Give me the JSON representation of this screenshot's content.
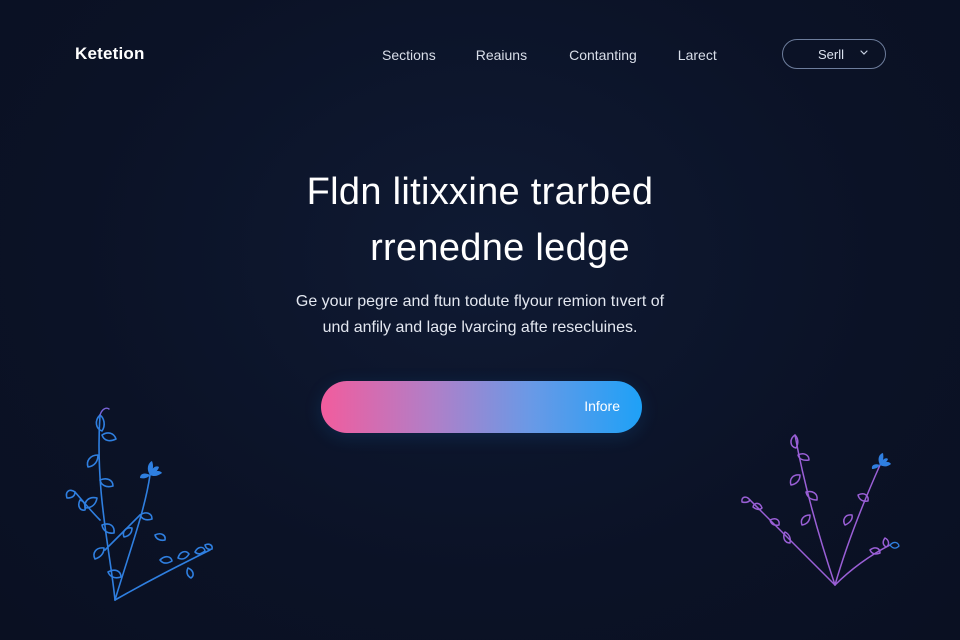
{
  "brand": {
    "name": "Ketetion"
  },
  "nav": {
    "items": [
      {
        "label": "Sections"
      },
      {
        "label": "Reaiuns"
      },
      {
        "label": "Contanting"
      },
      {
        "label": "Larect"
      }
    ]
  },
  "select": {
    "value": "Serll",
    "icon": "chevron-down-icon"
  },
  "hero": {
    "title_line1": "Fldn litixxine trarbed",
    "title_line2": "rrenedne ledge",
    "subtitle_line1": "Ge your pegre and ftun todute flyour remion tıvert of",
    "subtitle_line2": "und anfily and lage lvarcing afte resecluines."
  },
  "cta": {
    "label": "Infore"
  },
  "decor": {
    "left_plant": "fern-plant-icon",
    "right_plant": "fern-plant-icon",
    "colors": {
      "background": "#0b1226",
      "plant_blue": "#2f7fe0",
      "plant_purple": "#9a5fd6",
      "cta_start": "#f25c9d",
      "cta_end": "#1ea1f7"
    }
  }
}
